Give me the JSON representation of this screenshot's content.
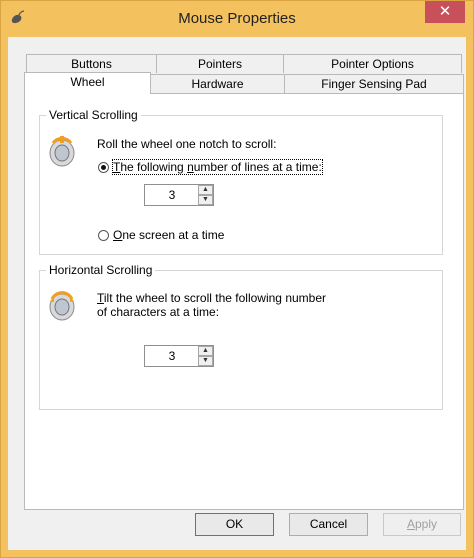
{
  "window": {
    "title": "Mouse Properties",
    "close_glyph": "✕"
  },
  "tabs": {
    "row1": [
      {
        "label": "Buttons"
      },
      {
        "label": "Pointers"
      },
      {
        "label": "Pointer Options"
      }
    ],
    "row2": [
      {
        "label": "Wheel",
        "active": true
      },
      {
        "label": "Hardware"
      },
      {
        "label": "Finger Sensing Pad"
      }
    ]
  },
  "vertical": {
    "legend": "Vertical Scrolling",
    "instruction": "Roll the wheel one notch to scroll:",
    "option_lines": {
      "key": "T",
      "rest": "he following ",
      "key2": "n",
      "rest2": "umber of lines at a time:",
      "checked": true
    },
    "lines_value": "3",
    "option_screen": {
      "key": "O",
      "rest": "ne screen at a time",
      "checked": false
    },
    "icon": "mouse-wheel-icon"
  },
  "horizontal": {
    "legend": "Horizontal Scrolling",
    "instruction_key": "T",
    "instruction_line1": "ilt the wheel to scroll the following number",
    "instruction_line2": "of characters at a time:",
    "chars_value": "3",
    "icon": "mouse-tilt-wheel-icon"
  },
  "buttons": {
    "ok": "OK",
    "cancel": "Cancel",
    "apply_key": "A",
    "apply_rest": "pply"
  },
  "colors": {
    "titlebar": "#f4c15f",
    "close": "#c7505a",
    "client": "#f0f0f0"
  }
}
